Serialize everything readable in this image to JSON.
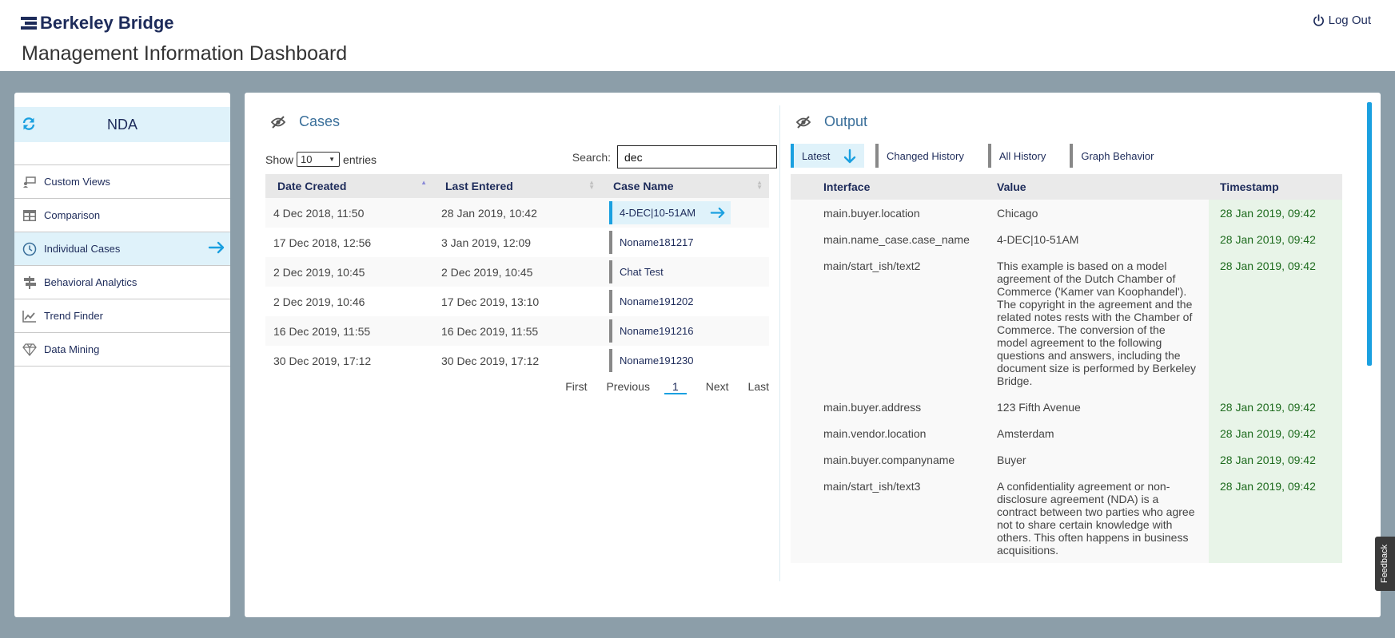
{
  "header": {
    "brand": "Berkeley Bridge",
    "title": "Management Information Dashboard",
    "logout_label": "Log Out"
  },
  "sidebar": {
    "project_name": "NDA",
    "items": [
      {
        "label": "Custom Views",
        "icon": "custom-views-icon"
      },
      {
        "label": "Comparison",
        "icon": "table-grid-icon"
      },
      {
        "label": "Individual Cases",
        "icon": "clock-icon",
        "active": true
      },
      {
        "label": "Behavioral Analytics",
        "icon": "signpost-icon"
      },
      {
        "label": "Trend Finder",
        "icon": "trend-chart-icon"
      },
      {
        "label": "Data Mining",
        "icon": "diamond-icon"
      }
    ]
  },
  "cases": {
    "title": "Cases",
    "show_label": "Show",
    "entries_value": "10",
    "entries_label": "entries",
    "search_label": "Search:",
    "search_value": "dec",
    "columns": [
      "Date Created",
      "Last Entered",
      "Case Name"
    ],
    "rows": [
      [
        "4 Dec 2018, 11:50",
        "28 Jan 2019, 10:42",
        "4-DEC|10-51AM"
      ],
      [
        "17 Dec 2018, 12:56",
        "3 Jan 2019, 12:09",
        "Noname181217"
      ],
      [
        "2 Dec 2019, 10:45",
        "2 Dec 2019, 10:45",
        "Chat Test"
      ],
      [
        "2 Dec 2019, 10:46",
        "17 Dec 2019, 13:10",
        "Noname191202"
      ],
      [
        "16 Dec 2019, 11:55",
        "16 Dec 2019, 11:55",
        "Noname191216"
      ],
      [
        "30 Dec 2019, 17:12",
        "30 Dec 2019, 17:12",
        "Noname191230"
      ]
    ],
    "pager": {
      "first": "First",
      "previous": "Previous",
      "current": "1",
      "next": "Next",
      "last": "Last"
    }
  },
  "output": {
    "title": "Output",
    "tabs": [
      "Latest",
      "Changed History",
      "All History",
      "Graph Behavior"
    ],
    "columns": [
      "Interface",
      "Value",
      "Timestamp"
    ],
    "rows": [
      [
        "main.buyer.location",
        "Chicago",
        "28 Jan 2019, 09:42"
      ],
      [
        "main.name_case.case_name",
        "4-DEC|10-51AM",
        "28 Jan 2019, 09:42"
      ],
      [
        "main/start_ish/text2",
        "This example is based on a model agreement of the Dutch Chamber of Commerce ('Kamer van Koophandel'). The copyright in the agreement and the related notes rests with the Chamber of Commerce. The conversion of the model agreement to the following questions and answers, including the document size is performed by Berkeley Bridge.",
        "28 Jan 2019, 09:42"
      ],
      [
        "main.buyer.address",
        "123 Fifth Avenue",
        "28 Jan 2019, 09:42"
      ],
      [
        "main.vendor.location",
        "Amsterdam",
        "28 Jan 2019, 09:42"
      ],
      [
        "main.buyer.companyname",
        "Buyer",
        "28 Jan 2019, 09:42"
      ],
      [
        "main/start_ish/text3",
        "A confidentiality agreement or non-disclosure agreement (NDA) is a contract between two parties who agree not to share certain knowledge with others. This often happens in business acquisitions.",
        "28 Jan 2019, 09:42"
      ]
    ]
  },
  "feedback_label": "Feedback",
  "colors": {
    "brand": "#1d2b5a",
    "accent": "#1aa0e0",
    "active_bg": "#dff2fa",
    "page_bg": "#8c9ea9"
  }
}
